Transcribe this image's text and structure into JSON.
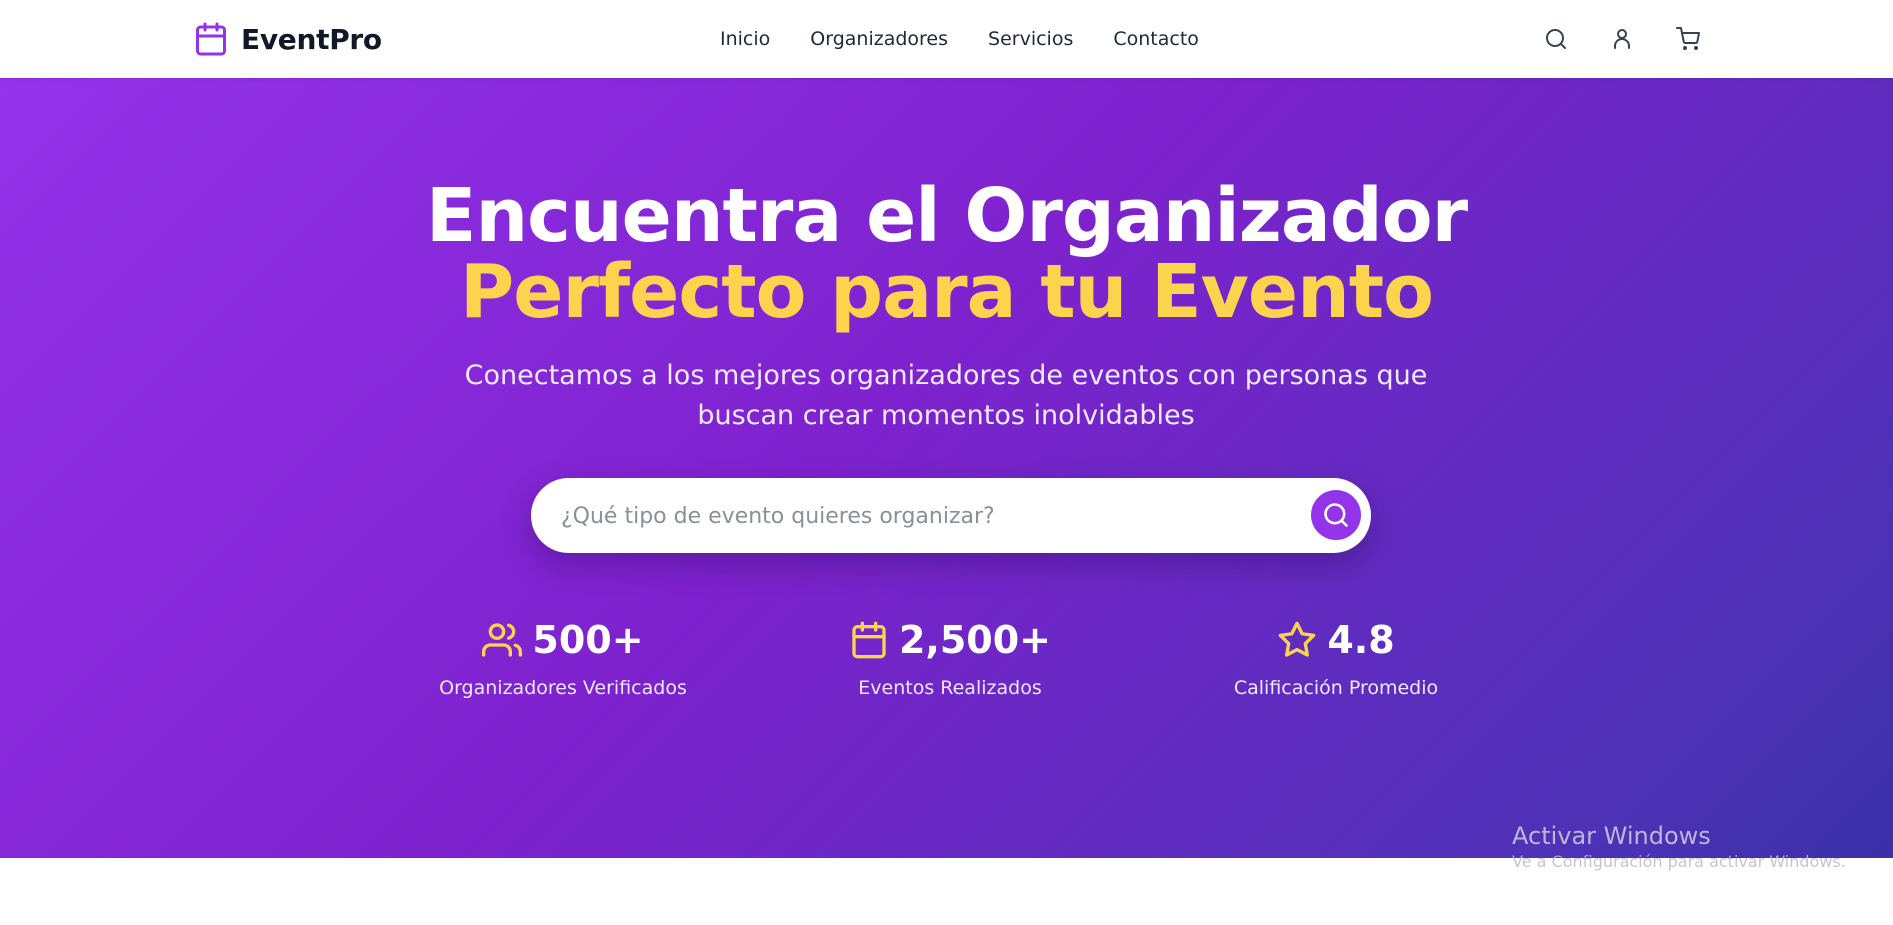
{
  "header": {
    "brand": "EventPro",
    "brand_icon": "calendar-icon",
    "nav": [
      {
        "label": "Inicio"
      },
      {
        "label": "Organizadores"
      },
      {
        "label": "Servicios"
      },
      {
        "label": "Contacto"
      }
    ],
    "actions": [
      "search-icon",
      "user-icon",
      "cart-icon"
    ]
  },
  "hero": {
    "headline_line1": "Encuentra el Organizador",
    "headline_line2": "Perfecto para tu Evento",
    "subtitle": "Conectamos a los mejores organizadores de eventos con personas que buscan crear momentos inolvidables",
    "search": {
      "placeholder": "¿Qué tipo de evento quieres organizar?",
      "value": "",
      "button_icon": "search-icon"
    },
    "stats": [
      {
        "icon": "users-icon",
        "value": "500+",
        "label": "Organizadores Verificados"
      },
      {
        "icon": "calendar-icon",
        "value": "2,500+",
        "label": "Eventos Realizados"
      },
      {
        "icon": "star-icon",
        "value": "4.8",
        "label": "Calificación Promedio"
      }
    ]
  },
  "watermark": {
    "title": "Activar Windows",
    "subtitle": "Ve a Configuración para activar Windows."
  },
  "colors": {
    "brand_purple": "#9333ea",
    "hero_gradient_start": "#9333ea",
    "hero_gradient_end": "#3b30a8",
    "accent_yellow": "#fcd34d",
    "text_dark": "#111827"
  }
}
